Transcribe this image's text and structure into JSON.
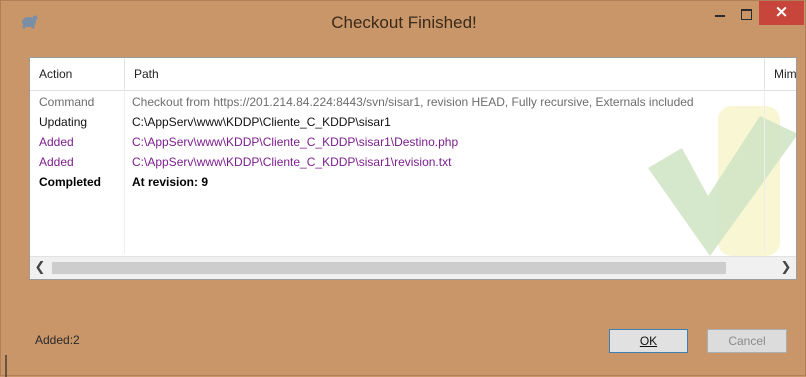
{
  "window": {
    "title": "Checkout Finished!"
  },
  "columns": {
    "action": "Action",
    "path": "Path",
    "mime": "Mim"
  },
  "rows": [
    {
      "action": "Command",
      "path": "Checkout from https://201.214.84.224:8443/svn/sisar1, revision HEAD, Fully recursive, Externals included",
      "color": "#6d6d6d",
      "bold": false
    },
    {
      "action": "Updating",
      "path": "C:\\AppServ\\www\\KDDP\\Cliente_C_KDDP\\sisar1",
      "color": "#111111",
      "bold": false
    },
    {
      "action": "Added",
      "path": "C:\\AppServ\\www\\KDDP\\Cliente_C_KDDP\\sisar1\\Destino.php",
      "color": "#7b1f8c",
      "bold": false
    },
    {
      "action": "Added",
      "path": "C:\\AppServ\\www\\KDDP\\Cliente_C_KDDP\\sisar1\\revision.txt",
      "color": "#7b1f8c",
      "bold": false
    },
    {
      "action": "Completed",
      "path": "At revision: 9",
      "color": "#000000",
      "bold": true
    }
  ],
  "status": {
    "text": "Added:2"
  },
  "buttons": {
    "ok": "OK",
    "cancel": "Cancel"
  },
  "colors": {
    "background": "#c99669",
    "close": "#c7453a",
    "added": "#7b1f8c",
    "accent": "#3c7fb1"
  },
  "icons": {
    "app": "tortoise-icon",
    "watermark": "checkmark-watermark-icon"
  }
}
